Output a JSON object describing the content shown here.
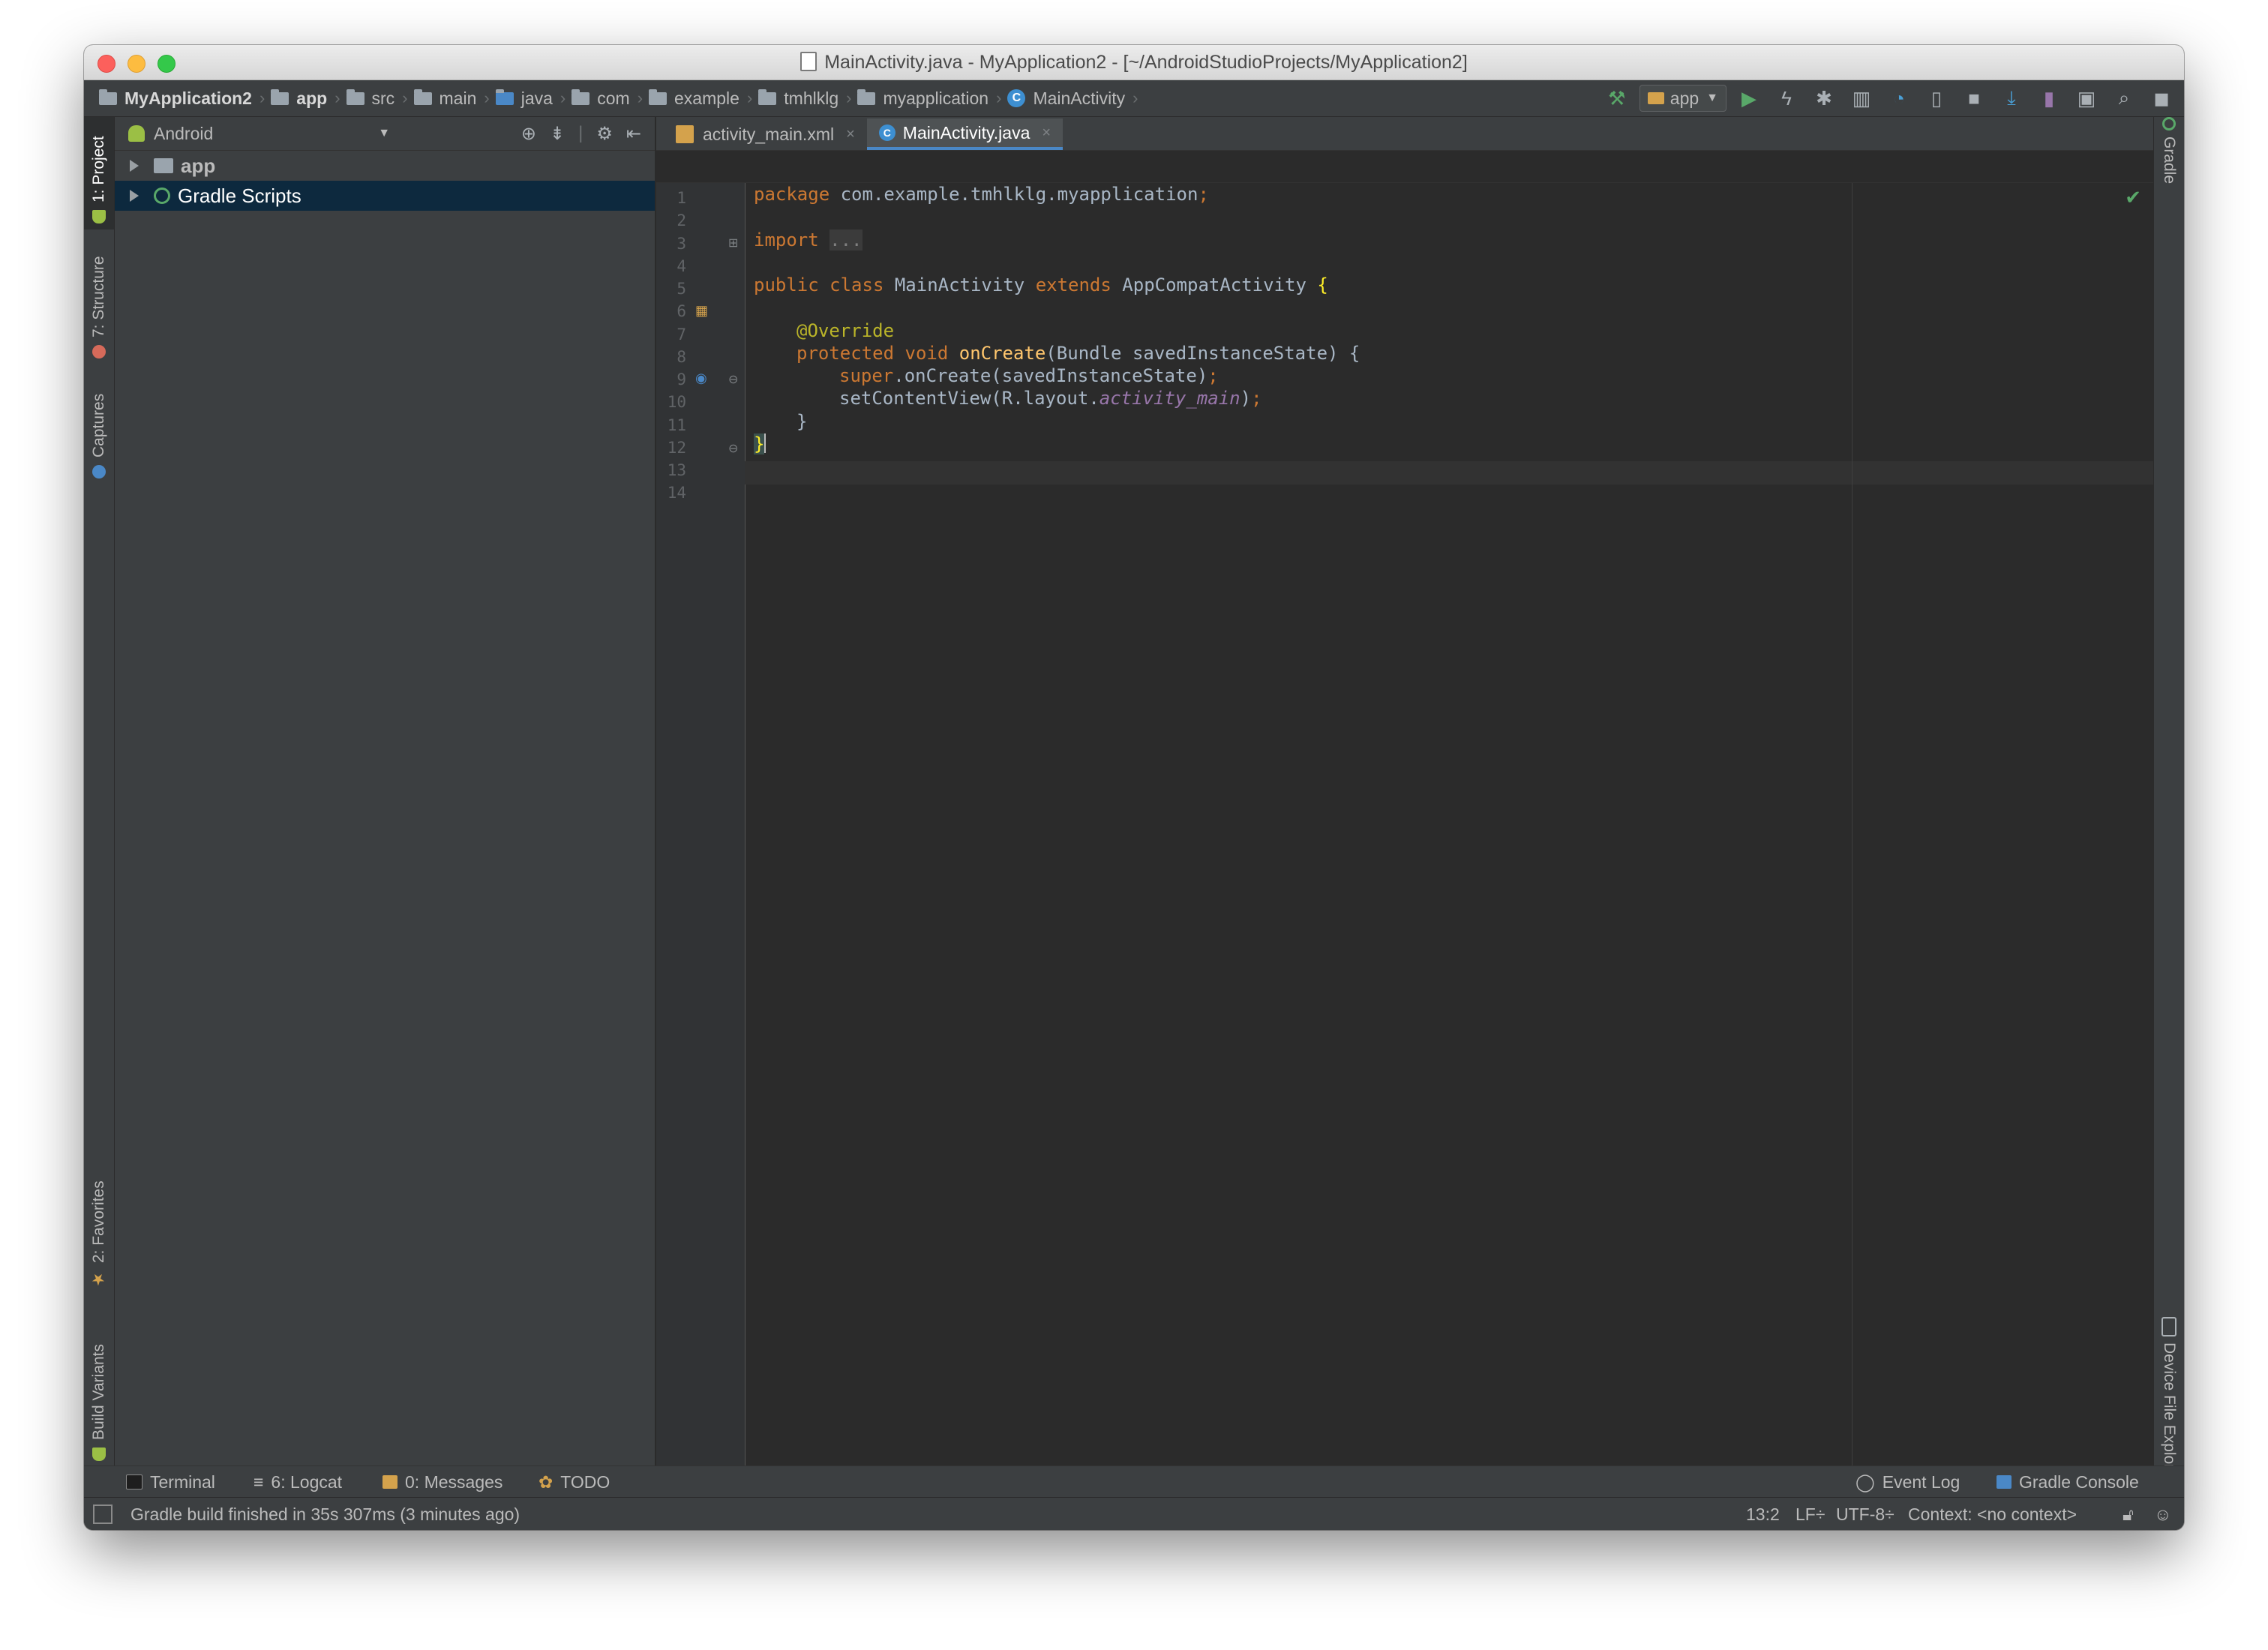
{
  "window": {
    "title": "MainActivity.java - MyApplication2 - [~/AndroidStudioProjects/MyApplication2]"
  },
  "breadcrumbs": [
    {
      "label": "MyApplication2",
      "type": "project"
    },
    {
      "label": "app",
      "type": "module"
    },
    {
      "label": "src",
      "type": "folder"
    },
    {
      "label": "main",
      "type": "folder"
    },
    {
      "label": "java",
      "type": "folder"
    },
    {
      "label": "com",
      "type": "folder"
    },
    {
      "label": "example",
      "type": "folder"
    },
    {
      "label": "tmhlklg",
      "type": "folder"
    },
    {
      "label": "myapplication",
      "type": "folder"
    },
    {
      "label": "MainActivity",
      "type": "class"
    }
  ],
  "toolbar": {
    "run_config": "app",
    "icons": [
      "build-hammer-icon",
      "run-icon",
      "instant-run-icon",
      "debug-icon",
      "attach-debugger-icon",
      "profile-icon",
      "apply-changes-icon",
      "stop-icon",
      "sdk-manager-icon",
      "avd-manager-icon",
      "project-structure-icon",
      "search-icon",
      "account-icon"
    ]
  },
  "left_tools": {
    "project": "1: Project",
    "structure": "7: Structure",
    "captures": "Captures",
    "favorites": "2: Favorites",
    "build_variants": "Build Variants"
  },
  "right_tools": {
    "gradle": "Gradle",
    "device_file_explorer": "Device File Explorer"
  },
  "project_panel": {
    "view_mode": "Android",
    "tree": [
      {
        "label": "app",
        "bold": true
      },
      {
        "label": "Gradle Scripts",
        "selected": true
      }
    ]
  },
  "editor": {
    "tabs": [
      {
        "label": "activity_main.xml",
        "active": false
      },
      {
        "label": "MainActivity.java",
        "active": true
      }
    ],
    "line_numbers": [
      "1",
      "2",
      "3",
      "4",
      "5",
      "6",
      "7",
      "8",
      "9",
      "10",
      "11",
      "12",
      "13",
      "14"
    ],
    "code": {
      "l1_kw": "package",
      "l1_rest": " com.example.tmhlklg.myapplication",
      "l1_semi": ";",
      "l3_kw": "import",
      "l3_fold": "...",
      "l6_kw1": "public class",
      "l6_name": " MainActivity ",
      "l6_kw2": "extends",
      "l6_super": " AppCompatActivity ",
      "l6_brace": "{",
      "l8_ann": "@Override",
      "l9_kw": "protected void",
      "l9_fn": "onCreate",
      "l9_rest": "(Bundle savedInstanceState) {",
      "l10_kw": "super",
      "l10_rest": ".onCreate(savedInstanceState)",
      "l10_semi": ";",
      "l11_a": "setContentView(R.layout.",
      "l11_it": "activity_main",
      "l11_b": ")",
      "l11_semi": ";",
      "l12": "}",
      "l13": "}"
    }
  },
  "bottom_tools": {
    "terminal": "Terminal",
    "logcat": "6: Logcat",
    "messages": "0: Messages",
    "todo": "TODO",
    "event_log": "Event Log",
    "gradle_console": "Gradle Console"
  },
  "status": {
    "message": "Gradle build finished in 35s 307ms (3 minutes ago)",
    "position": "13:2",
    "line_sep": "LF÷",
    "encoding": "UTF-8÷",
    "context": "Context: <no context>"
  }
}
